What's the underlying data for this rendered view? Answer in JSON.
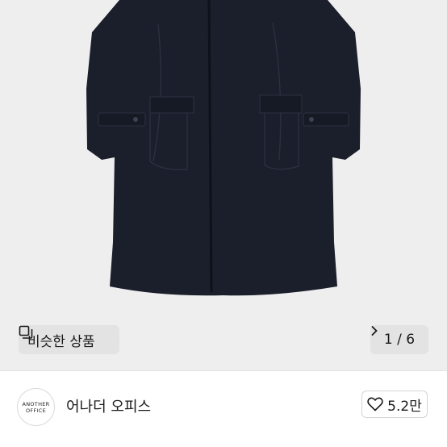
{
  "product": {
    "image_alt": "navy wool coat"
  },
  "similar": {
    "label": "비슷한 상품",
    "icon": "similar-items-icon"
  },
  "pager": {
    "text": "1 / 6",
    "icon": "chevron-right-icon"
  },
  "shop": {
    "logo_line1": "ANOTHER",
    "logo_line2": "OFFICE",
    "name": "어나더 오피스",
    "like_count": "5.2만",
    "like_icon": "heart-outline-icon"
  },
  "colors": {
    "image_bg": "#eeeeef",
    "coat": "#1b1f2b"
  }
}
